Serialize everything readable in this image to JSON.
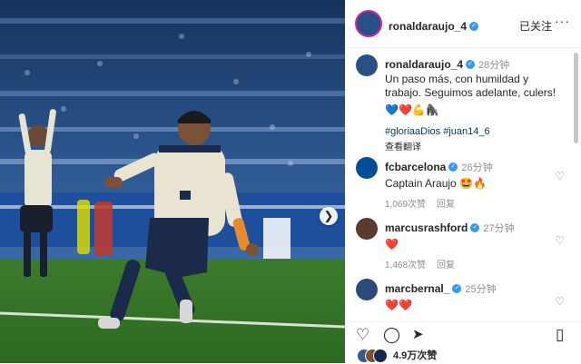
{
  "post": {
    "author": "ronaldaraujo_4",
    "follow_label": "已关注",
    "caption": "Un paso más, con humildad y trabajo. Seguimos adelante, culers!",
    "caption_emoji": "💙❤️💪🦍",
    "caption_time": "28分钟",
    "hashtags": "#gloriaaDios #juan14_6",
    "translate_label": "查看翻译",
    "likes_label": "4.9万次赞"
  },
  "comments": [
    {
      "user": "fcbarcelona",
      "time": "26分钟",
      "text": "Captain Araujo 🤩🔥",
      "likes": "1,069次赞",
      "reply": "回复"
    },
    {
      "user": "marcusrashford",
      "time": "27分钟",
      "text": "❤️",
      "likes": "1,468次赞",
      "reply": "回复"
    },
    {
      "user": "marcbernal_",
      "time": "25分钟",
      "text": "❤️❤️",
      "likes": "",
      "reply": ""
    }
  ],
  "icons": [
    "verified-icon",
    "more-icon",
    "heart-icon",
    "comment-icon",
    "share-icon",
    "bookmark-icon",
    "next-arrow-icon"
  ],
  "colors": {
    "verified": "#3897f0",
    "heart": "#ed4956",
    "barca_blue": "#004d98",
    "barca_red": "#a50044"
  }
}
